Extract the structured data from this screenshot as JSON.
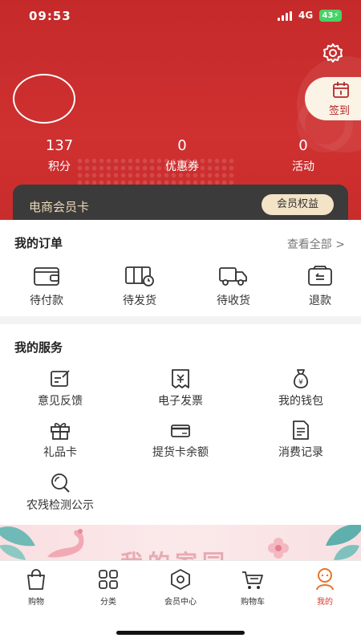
{
  "status": {
    "time": "09:53",
    "network": "4G",
    "battery": "43"
  },
  "checkin": {
    "label": "签到"
  },
  "stats": [
    {
      "value": "137",
      "label": "积分"
    },
    {
      "value": "0",
      "label": "优惠券"
    },
    {
      "value": "0",
      "label": "活动"
    }
  ],
  "member": {
    "title": "电商会员卡",
    "benefits_button": "会员权益"
  },
  "orders": {
    "title": "我的订单",
    "view_all": "查看全部 >",
    "items": [
      {
        "label": "待付款",
        "icon": "wallet-icon"
      },
      {
        "label": "待发货",
        "icon": "box-clock-icon"
      },
      {
        "label": "待收货",
        "icon": "truck-icon"
      },
      {
        "label": "退款",
        "icon": "refund-icon"
      }
    ]
  },
  "services": {
    "title": "我的服务",
    "items": [
      {
        "label": "意见反馈",
        "icon": "feedback-icon"
      },
      {
        "label": "电子发票",
        "icon": "invoice-icon"
      },
      {
        "label": "我的钱包",
        "icon": "money-bag-icon"
      },
      {
        "label": "礼品卡",
        "icon": "gift-icon"
      },
      {
        "label": "提货卡余额",
        "icon": "card-icon"
      },
      {
        "label": "消费记录",
        "icon": "record-icon"
      },
      {
        "label": "农残检测公示",
        "icon": "search-icon"
      }
    ]
  },
  "banner": {
    "text": "我的家园"
  },
  "tabbar": {
    "active_color": "#d63a2d",
    "items": [
      {
        "label": "购物",
        "icon": "shopping-bag-icon"
      },
      {
        "label": "分类",
        "icon": "category-grid-icon"
      },
      {
        "label": "会员中心",
        "icon": "member-hexagon-icon"
      },
      {
        "label": "购物车",
        "icon": "cart-icon"
      },
      {
        "label": "我的",
        "icon": "profile-icon"
      }
    ]
  }
}
